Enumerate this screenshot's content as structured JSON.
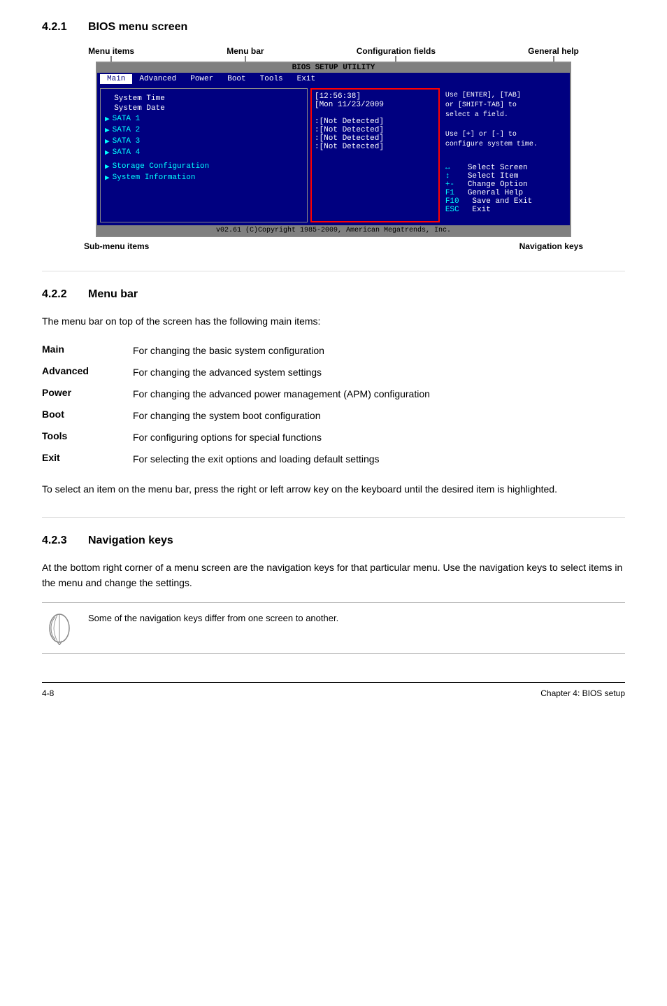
{
  "sections": {
    "s421": {
      "number": "4.2.1",
      "title": "BIOS menu screen"
    },
    "s422": {
      "number": "4.2.2",
      "title": "Menu bar"
    },
    "s423": {
      "number": "4.2.3",
      "title": "Navigation keys"
    }
  },
  "diagram": {
    "top_labels": [
      "Menu items",
      "Menu bar",
      "Configuration fields",
      "General help"
    ],
    "bottom_labels": [
      "Sub-menu items",
      "Navigation keys"
    ]
  },
  "bios": {
    "title": "BIOS SETUP UTILITY",
    "menu_items": [
      "Main",
      "Advanced",
      "Power",
      "Boot",
      "Tools",
      "Exit"
    ],
    "selected_menu": "Main",
    "left_panel": [
      {
        "type": "normal",
        "label": "System Time"
      },
      {
        "type": "normal",
        "label": "System Date"
      },
      {
        "type": "arrow",
        "label": "SATA 1"
      },
      {
        "type": "arrow",
        "label": "SATA 2"
      },
      {
        "type": "arrow",
        "label": "SATA 3"
      },
      {
        "type": "arrow",
        "label": "SATA 4"
      },
      {
        "type": "arrow",
        "label": "Storage Configuration"
      },
      {
        "type": "arrow",
        "label": "System Information"
      }
    ],
    "center_panel": [
      "[12:56:38]",
      "[Mon 11/23/2009",
      "",
      ":[Not Detected]",
      ":[Not Detected]",
      ":[Not Detected]",
      ":[Not Detected]"
    ],
    "right_panel": {
      "help": [
        "Use [ENTER], [TAB]",
        "or [SHIFT-TAB] to",
        "select a field.",
        "",
        "Use [+] or [-] to",
        "configure system time."
      ],
      "nav_keys": [
        {
          "key": "↔",
          "desc": "Select Screen"
        },
        {
          "key": "↕",
          "desc": "Select Item"
        },
        {
          "key": "+-",
          "desc": "Change Option"
        },
        {
          "key": "F1",
          "desc": "General Help"
        },
        {
          "key": "F10",
          "desc": "Save and Exit"
        },
        {
          "key": "ESC",
          "desc": "Exit"
        }
      ]
    },
    "footer": "v02.61  (C)Copyright 1985-2009, American Megatrends, Inc."
  },
  "s422_content": {
    "intro": "The menu bar on top of the screen has the following main items:",
    "items": [
      {
        "name": "Main",
        "desc": "For changing the basic system configuration"
      },
      {
        "name": "Advanced",
        "desc": "For changing the advanced system settings"
      },
      {
        "name": "Power",
        "desc": "For changing the advanced power management (APM) configuration"
      },
      {
        "name": "Boot",
        "desc": "For changing the system boot configuration"
      },
      {
        "name": "Tools",
        "desc": "For configuring options for special functions"
      },
      {
        "name": "Exit",
        "desc": "For selecting the exit options and loading default settings"
      }
    ],
    "footer": "To select an item on the menu bar, press the right or left arrow key on the keyboard until the desired item is highlighted."
  },
  "s423_content": {
    "intro": "At the bottom right corner of a menu screen are the navigation keys for that particular menu. Use the navigation keys to select items in the menu and change the settings.",
    "note": "Some of the navigation keys differ from one screen to another."
  },
  "page_footer": {
    "left": "4-8",
    "right": "Chapter 4: BIOS setup"
  }
}
